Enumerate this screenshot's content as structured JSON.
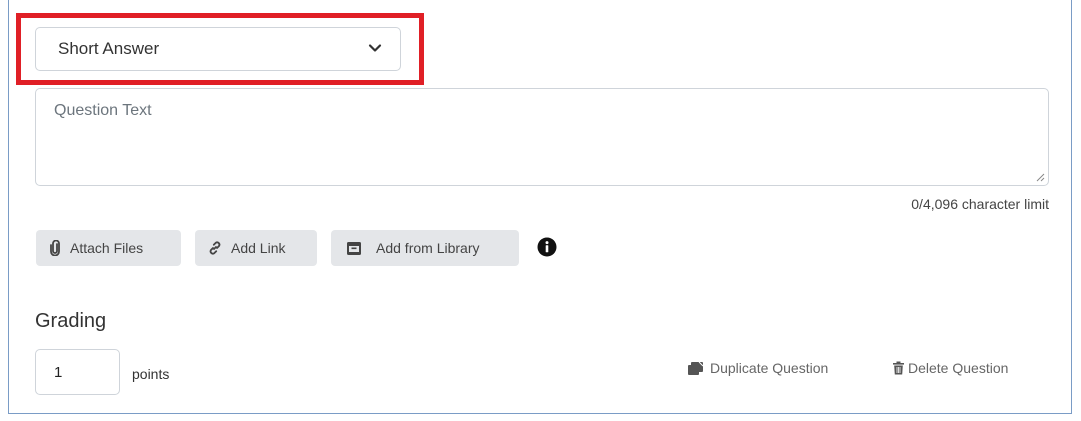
{
  "question_type": {
    "selected": "Short Answer"
  },
  "question_text": {
    "placeholder": "Question Text",
    "char_limit_label": "0/4,096 character limit"
  },
  "toolbar": {
    "attach_label": "Attach Files",
    "link_label": "Add Link",
    "library_label": "Add from Library"
  },
  "grading": {
    "title": "Grading",
    "points_value": "1",
    "points_label": "points"
  },
  "actions": {
    "duplicate_label": "Duplicate Question",
    "delete_label": "Delete Question"
  },
  "colors": {
    "highlight": "#e01f26",
    "panel_border": "#7a9cc6",
    "button_bg": "#e4e6e9"
  }
}
